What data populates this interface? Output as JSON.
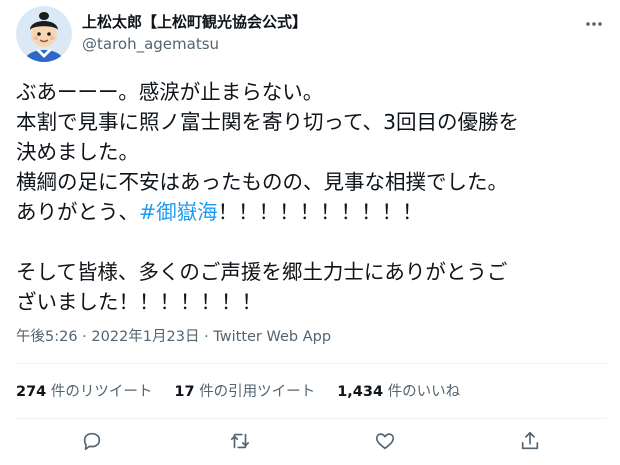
{
  "user": {
    "display_name": "上松太郎【上松町観光協会公式】",
    "handle": "@taroh_agematsu"
  },
  "tweet": {
    "lines": [
      "ぶあーーー。感涙が止まらない。",
      "本割で見事に照ノ富士関を寄り切って、3回目の優勝を",
      "決めました。",
      "横綱の足に不安はあったものの、見事な相撲でした。",
      "ありがとう、",
      "#御嶽海",
      "！！！！！！！！！！",
      "そして皆様、多くのご声援を郷土力士にありがとうご",
      "ざいました！！！！！！！"
    ]
  },
  "meta": {
    "timestamp": "午後5:26 · 2022年1月23日 · Twitter Web App"
  },
  "stats": {
    "retweets_count": "274",
    "retweets_label": "件のリツイート",
    "quotes_count": "17",
    "quotes_label": "件の引用ツイート",
    "likes_count": "1,434",
    "likes_label": "件のいいね"
  },
  "icons": {
    "more": "more-icon",
    "reply": "reply-icon",
    "retweet": "retweet-icon",
    "like": "heart-icon",
    "share": "share-icon"
  },
  "colors": {
    "text": "#0f1419",
    "secondary": "#536471",
    "link": "#1d9bf0",
    "divider": "#eff3f4"
  }
}
